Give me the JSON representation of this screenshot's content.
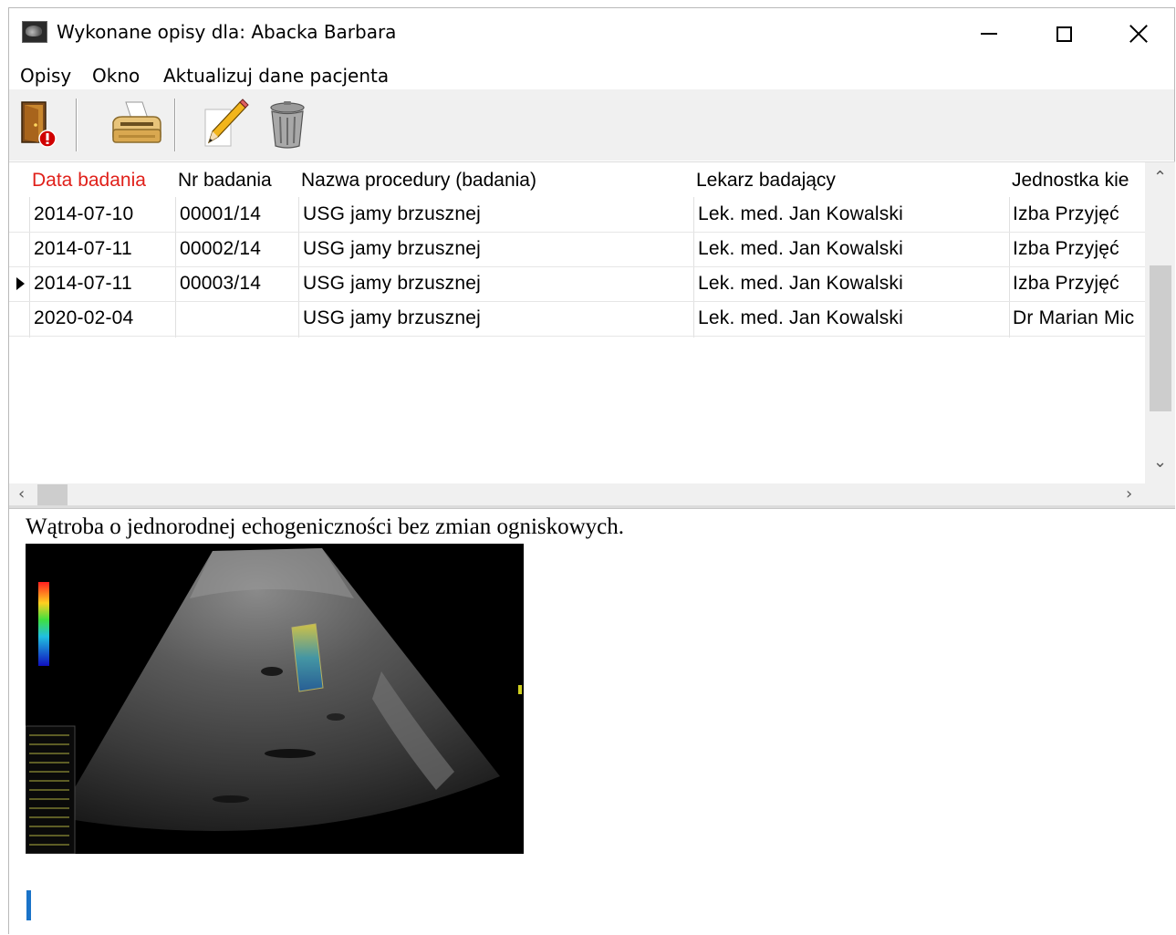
{
  "window": {
    "title": "Wykonane opisy dla: Abacka Barbara"
  },
  "menu": {
    "items": [
      "Opisy",
      "Okno",
      "Aktualizuj dane pacjenta"
    ]
  },
  "toolbar": {
    "buttons": [
      "exit-door-icon",
      "printer-icon",
      "pencil-edit-icon",
      "trash-bin-icon"
    ]
  },
  "grid": {
    "columns": [
      "Data badania",
      "Nr badania",
      "Nazwa procedury (badania)",
      "Lekarz badający",
      "Jednostka kie"
    ],
    "sorted_column_color": "#e0201a",
    "rows": [
      {
        "date": "2014-07-10",
        "number": "00001/14",
        "procedure": "USG jamy brzusznej",
        "doctor": "Lek. med. Jan Kowalski",
        "unit": "Izba Przyjęć"
      },
      {
        "date": "2014-07-11",
        "number": "00002/14",
        "procedure": "USG jamy brzusznej",
        "doctor": "Lek. med. Jan Kowalski",
        "unit": "Izba Przyjęć"
      },
      {
        "date": "2014-07-11",
        "number": "00003/14",
        "procedure": "USG jamy brzusznej",
        "doctor": "Lek. med. Jan Kowalski",
        "unit": "Izba Przyjęć"
      },
      {
        "date": "2020-02-04",
        "number": "",
        "procedure": "USG jamy brzusznej",
        "doctor": "Lek. med. Jan Kowalski",
        "unit": "Dr Marian Mic"
      }
    ],
    "current_row": 2
  },
  "description": {
    "text": "Wątroba o jednorodnej echogeniczności bez zmian ogniskowych."
  }
}
